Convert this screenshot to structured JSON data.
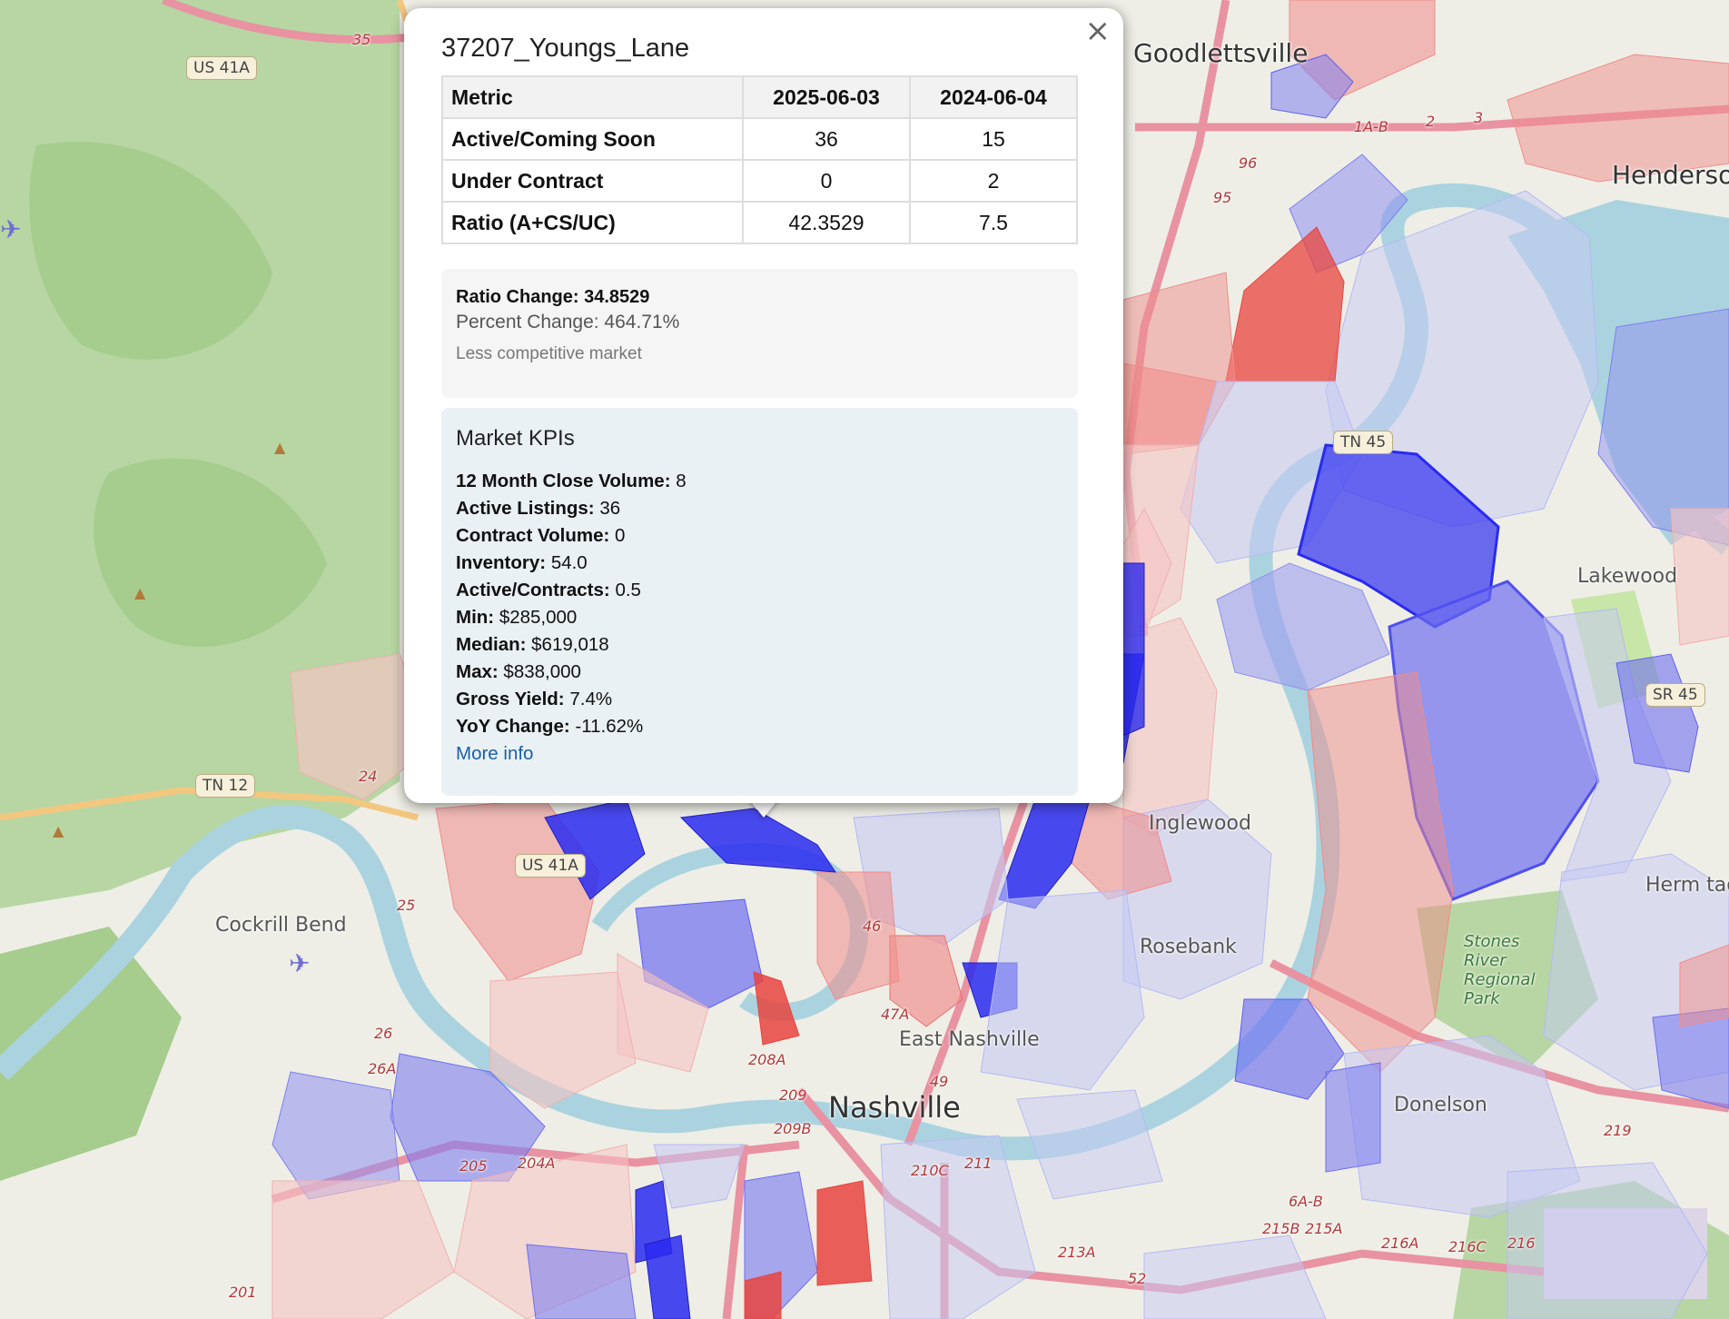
{
  "map": {
    "labels": {
      "goodlettsville": "Goodlettsville",
      "henderson": "Hendersor",
      "lakewood": "Lakewood",
      "hermitage": "Herm tag",
      "cockrill_bend": "Cockrill Bend",
      "nashville": "Nashville",
      "east_nashville": "East Nashville",
      "donelson": "Donelson",
      "inglewood": "Inglewood",
      "rosebank": "Rosebank",
      "stones_river": "Stones River Regional Park"
    },
    "shields": {
      "us41a_top": "US 41A",
      "us41a_mid": "US 41A",
      "tn12": "TN 12",
      "tn45": "TN 45",
      "sr45": "SR 45"
    },
    "exits": [
      "35",
      "96",
      "95",
      "24",
      "25",
      "26",
      "26A",
      "201",
      "205",
      "204A",
      "208A",
      "209",
      "209B",
      "210C",
      "211",
      "213A",
      "52",
      "215B",
      "215A",
      "216A",
      "216C",
      "216",
      "219",
      "6A-B",
      "49",
      "47A",
      "46",
      "1A-B",
      "2",
      "3"
    ]
  },
  "popup": {
    "title": "37207_Youngs_Lane",
    "close_symbol": "×",
    "table": {
      "headers": [
        "Metric",
        "2025-06-03",
        "2024-06-04"
      ],
      "rows": [
        [
          "Active/Coming Soon",
          "36",
          "15"
        ],
        [
          "Under Contract",
          "0",
          "2"
        ],
        [
          "Ratio (A+CS/UC)",
          "42.3529",
          "7.5"
        ]
      ]
    },
    "change": {
      "ratio_change": "Ratio Change: 34.8529",
      "percent_change": "Percent Change: 464.71%",
      "note": "Less competitive market"
    },
    "kpis": {
      "title": "Market KPIs",
      "items": [
        {
          "label": "12 Month Close Volume:",
          "value": "8"
        },
        {
          "label": "Active Listings:",
          "value": "36"
        },
        {
          "label": "Contract Volume:",
          "value": "0"
        },
        {
          "label": "Inventory:",
          "value": "54.0"
        },
        {
          "label": "Active/Contracts:",
          "value": "0.5"
        },
        {
          "label": "Min:",
          "value": "$285,000"
        },
        {
          "label": "Median:",
          "value": "$619,018"
        },
        {
          "label": "Max:",
          "value": "$838,000"
        },
        {
          "label": "Gross Yield:",
          "value": "7.4%"
        },
        {
          "label": "YoY Change:",
          "value": "-11.62%"
        }
      ],
      "more_info": "More info"
    }
  },
  "colors": {
    "strong_blue": "#2a2af0",
    "mid_blue": "#7f7ff0",
    "light_blue": "#c6c9f3",
    "strong_red": "#e8443f",
    "mid_red": "#f08c8a",
    "light_red": "#f5c4c3",
    "water": "#aad3df",
    "forest": "#add19e"
  }
}
